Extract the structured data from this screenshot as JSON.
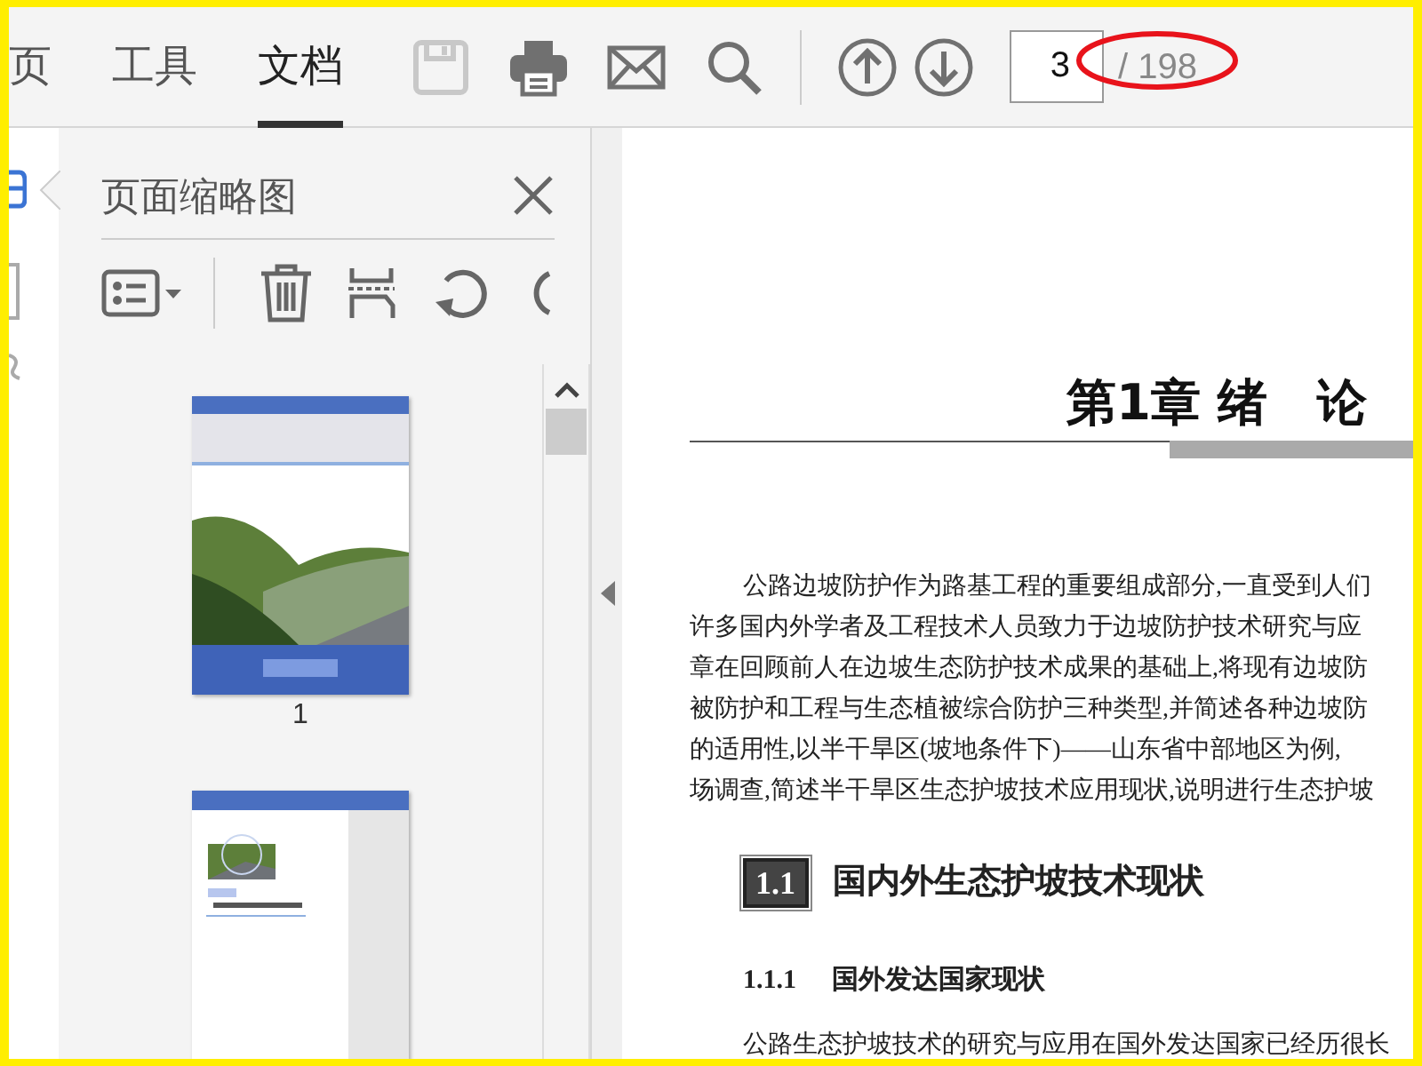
{
  "tabs": [
    {
      "label": "页",
      "selected": false
    },
    {
      "label": "工具",
      "selected": false
    },
    {
      "label": "文档",
      "selected": true
    }
  ],
  "tools": [
    {
      "kind": "save",
      "disabled": true
    },
    {
      "kind": "print",
      "disabled": false
    },
    {
      "kind": "mail",
      "disabled": false
    },
    {
      "kind": "search",
      "disabled": false
    }
  ],
  "page_nav": {
    "current": "3",
    "total": "/ 198",
    "highlighted": true
  },
  "panel": {
    "title": "页面缩略图",
    "thumbnails": [
      {
        "kind": "cover",
        "label": "1"
      },
      {
        "kind": "title_page"
      }
    ]
  },
  "document": {
    "chapter_title": "第1章 绪　论",
    "paragraph_1": [
      "公路边坡防护作为路基工程的重要组成部分,一直受到人们",
      "许多国内外学者及工程技术人员致力于边坡防护技术研究与应",
      "章在回顾前人在边坡生态防护技术成果的基础上,将现有边坡防",
      "被防护和工程与生态植被综合防护三种类型,并简述各种边坡防",
      "的适用性,以半干旱区(坡地条件下)——山东省中部地区为例,",
      "场调查,简述半干旱区生态护坡技术应用现状,说明进行生态护坡"
    ],
    "section": {
      "number": "1.1",
      "title": "国内外生态护坡技术现状"
    },
    "subsection": {
      "number": "1.1.1",
      "title": "国外发达国家现状"
    },
    "paragraph_2": [
      "公路生态护坡技术的研究与应用在国外发达国家已经历很长"
    ]
  }
}
